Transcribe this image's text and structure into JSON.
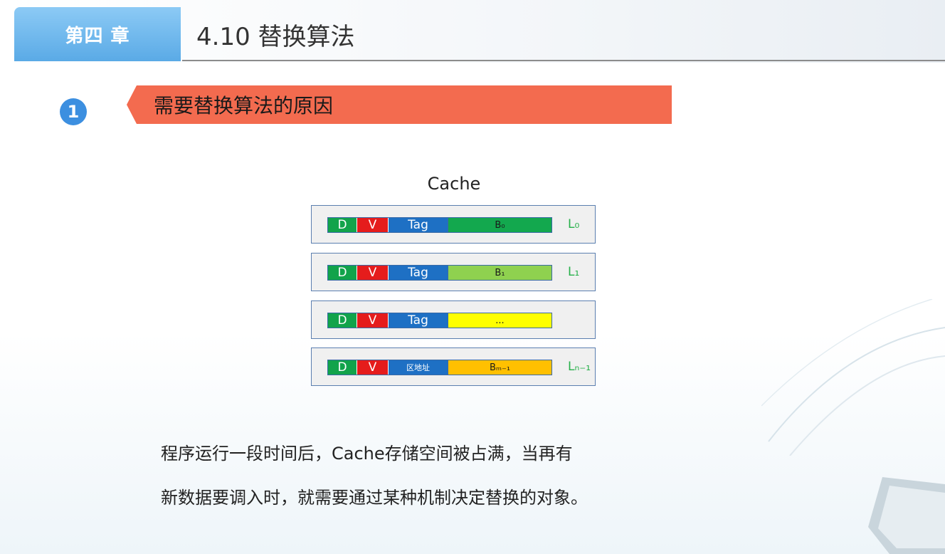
{
  "header": {
    "chapter_label": "第四 章",
    "section_title": "4.10 替换算法"
  },
  "topic": {
    "number": "1",
    "title": "需要替换算法的原因"
  },
  "diagram": {
    "title": "Cache",
    "rows": [
      {
        "d": "D",
        "v": "V",
        "tag": "Tag",
        "block": "B₀",
        "block_color": "#13a84e",
        "label": "L₀"
      },
      {
        "d": "D",
        "v": "V",
        "tag": "Tag",
        "block": "B₁",
        "block_color": "#8fd14f",
        "label": "L₁"
      },
      {
        "d": "D",
        "v": "V",
        "tag": "Tag",
        "block": "...",
        "block_color": "#ffff00",
        "label": ""
      },
      {
        "d": "D",
        "v": "V",
        "tag": "区地址",
        "block": "Bₘ₋₁",
        "block_color": "#ffc000",
        "label": "Lₙ₋₁"
      }
    ]
  },
  "body": {
    "line1": "程序运行一段时间后，Cache存储空间被占满，当再有",
    "line2": "新数据要调入时，就需要通过某种机制决定替换的对象。"
  },
  "colors": {
    "accent_blue": "#5aaae6",
    "banner_red": "#f36b4f",
    "d_green": "#12a34b",
    "v_red": "#e51c1c",
    "tag_blue": "#1e70c4"
  }
}
